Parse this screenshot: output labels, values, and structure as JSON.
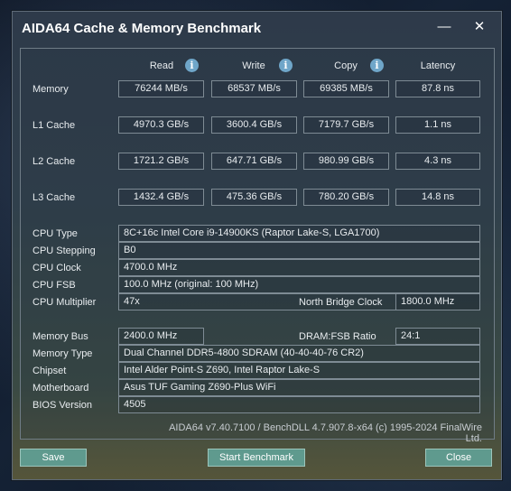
{
  "window": {
    "title": "AIDA64 Cache & Memory Benchmark",
    "minimize_icon": "minimize-icon",
    "close_icon": "close-icon"
  },
  "columns": {
    "read": "Read",
    "write": "Write",
    "copy": "Copy",
    "latency": "Latency"
  },
  "rows": {
    "memory": {
      "label": "Memory",
      "read": "76244 MB/s",
      "write": "68537 MB/s",
      "copy": "69385 MB/s",
      "latency": "87.8 ns"
    },
    "l1": {
      "label": "L1 Cache",
      "read": "4970.3 GB/s",
      "write": "3600.4 GB/s",
      "copy": "7179.7 GB/s",
      "latency": "1.1 ns"
    },
    "l2": {
      "label": "L2 Cache",
      "read": "1721.2 GB/s",
      "write": "647.71 GB/s",
      "copy": "980.99 GB/s",
      "latency": "4.3 ns"
    },
    "l3": {
      "label": "L3 Cache",
      "read": "1432.4 GB/s",
      "write": "475.36 GB/s",
      "copy": "780.20 GB/s",
      "latency": "14.8 ns"
    }
  },
  "cpu": {
    "type_label": "CPU Type",
    "type": "8C+16c Intel Core i9-14900KS  (Raptor Lake-S, LGA1700)",
    "stepping_label": "CPU Stepping",
    "stepping": "B0",
    "clock_label": "CPU Clock",
    "clock": "4700.0 MHz",
    "fsb_label": "CPU FSB",
    "fsb": "100.0 MHz  (original: 100 MHz)",
    "multiplier_label": "CPU Multiplier",
    "multiplier": "47x",
    "nb_clock_label": "North Bridge Clock",
    "nb_clock": "1800.0 MHz"
  },
  "memory_info": {
    "bus_label": "Memory Bus",
    "bus": "2400.0 MHz",
    "ratio_label": "DRAM:FSB Ratio",
    "ratio": "24:1",
    "type_label": "Memory Type",
    "type": "Dual Channel DDR5-4800 SDRAM  (40-40-40-76 CR2)",
    "chipset_label": "Chipset",
    "chipset": "Intel Alder Point-S Z690, Intel Raptor Lake-S",
    "motherboard_label": "Motherboard",
    "motherboard": "Asus TUF Gaming Z690-Plus WiFi",
    "bios_label": "BIOS Version",
    "bios": "4505"
  },
  "footer": "AIDA64 v7.40.7100 / BenchDLL 4.7.907.8-x64  (c) 1995-2024 FinalWire Ltd.",
  "buttons": {
    "save": "Save",
    "start": "Start Benchmark",
    "close": "Close"
  }
}
